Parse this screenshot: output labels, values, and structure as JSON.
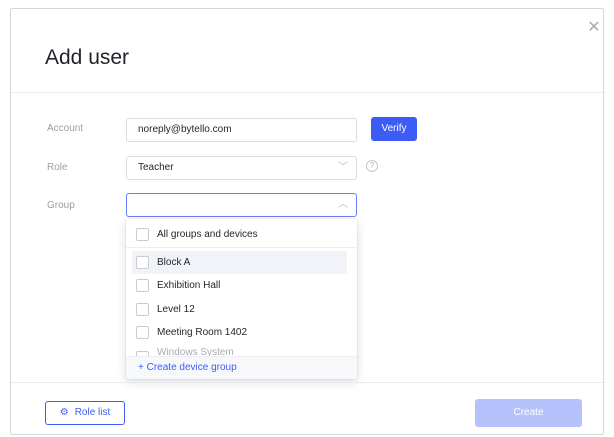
{
  "dialog": {
    "title": "Add user",
    "close_icon": "close-icon"
  },
  "form": {
    "account": {
      "label": "Account",
      "value": "noreply@bytello.com"
    },
    "verify_label": "Verify",
    "role": {
      "label": "Role",
      "value": "Teacher",
      "help_icon": "question-circle-icon"
    },
    "group": {
      "label": "Group",
      "value": ""
    }
  },
  "group_dropdown": {
    "items": [
      {
        "label": "All groups and devices",
        "checked": false
      },
      {
        "label": "Block A",
        "checked": false,
        "hovered": true
      },
      {
        "label": "Exhibition Hall",
        "checked": false
      },
      {
        "label": "Level 12",
        "checked": false
      },
      {
        "label": "Meeting Room 1402",
        "checked": false
      },
      {
        "label": "Windows System",
        "checked": false
      }
    ],
    "create_label": "+ Create device group"
  },
  "footer": {
    "role_list_label": "Role list",
    "role_list_icon": "gear-icon",
    "create_label": "Create"
  },
  "colors": {
    "primary": "#3d5cf5",
    "primary_disabled": "#b6c2fb"
  }
}
